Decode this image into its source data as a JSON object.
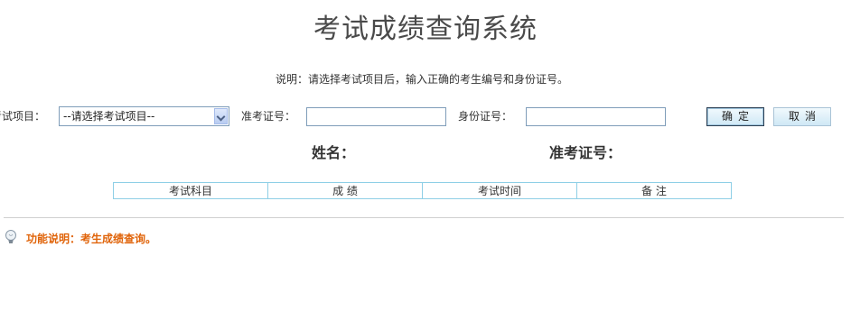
{
  "header": {
    "title": "考试成绩查询系统"
  },
  "instructions": "说明：请选择考试项目后，输入正确的考生编号和身份证号。",
  "form": {
    "project_label": "考试项目：",
    "project_select_value": "--请选择考试项目--",
    "ticket_label": "准考证号：",
    "ticket_value": "",
    "id_label": "身份证号：",
    "id_value": "",
    "confirm_label": "确定",
    "cancel_label": "取消"
  },
  "candidate": {
    "name_label": "姓名：",
    "ticket_label": "准考证号："
  },
  "table": {
    "columns": [
      "考试科目",
      "成 绩",
      "考试时间",
      "备 注"
    ]
  },
  "footer": {
    "icon": "lightbulb-icon",
    "note": "功能说明：考生成绩查询。"
  },
  "colors": {
    "note_orange": "#e0640a",
    "table_border": "#8ecfe6",
    "input_border": "#7f9db9"
  }
}
